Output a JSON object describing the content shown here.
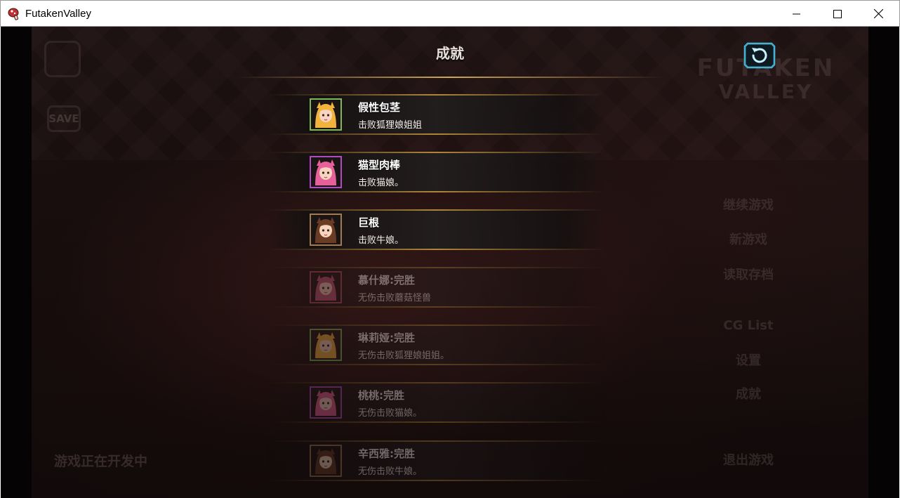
{
  "window": {
    "title": "FutakenValley"
  },
  "screen": {
    "title": "成就",
    "back_icon": "refresh-back-icon"
  },
  "background": {
    "logo_line1": "FUTAKEN",
    "logo_line2": "VALLEY",
    "dev_notice": "游戏正在开发中",
    "save_label": "SAVE",
    "menu": [
      "继续游戏",
      "新游戏",
      "读取存档",
      "CG List",
      "设置",
      "成就",
      "退出游戏"
    ]
  },
  "achievements": [
    {
      "name": "假性包茎",
      "desc": "击败狐狸娘姐姐",
      "unlocked": true,
      "frame_color": "#7fb85a",
      "hair_color": "#f0b43c"
    },
    {
      "name": "猫型肉棒",
      "desc": "击败猫娘。",
      "unlocked": true,
      "frame_color": "#b04cc0",
      "hair_color": "#e8609a"
    },
    {
      "name": "巨根",
      "desc": "击败牛娘。",
      "unlocked": true,
      "frame_color": "#a07a52",
      "hair_color": "#6a3c24"
    },
    {
      "name": "慕什娜:完胜",
      "desc": "无伤击败蘑菇怪兽",
      "unlocked": false,
      "frame_color": "#b05060",
      "hair_color": "#c05878"
    },
    {
      "name": "琳莉娅:完胜",
      "desc": "无伤击败狐狸娘姐姐。",
      "unlocked": false,
      "frame_color": "#7fb85a",
      "hair_color": "#f0b43c"
    },
    {
      "name": "桃桃:完胜",
      "desc": "无伤击败猫娘。",
      "unlocked": false,
      "frame_color": "#b04cc0",
      "hair_color": "#e8609a"
    },
    {
      "name": "辛西雅:完胜",
      "desc": "无伤击败牛娘。",
      "unlocked": false,
      "frame_color": "#a07a52",
      "hair_color": "#6a3c24"
    }
  ]
}
